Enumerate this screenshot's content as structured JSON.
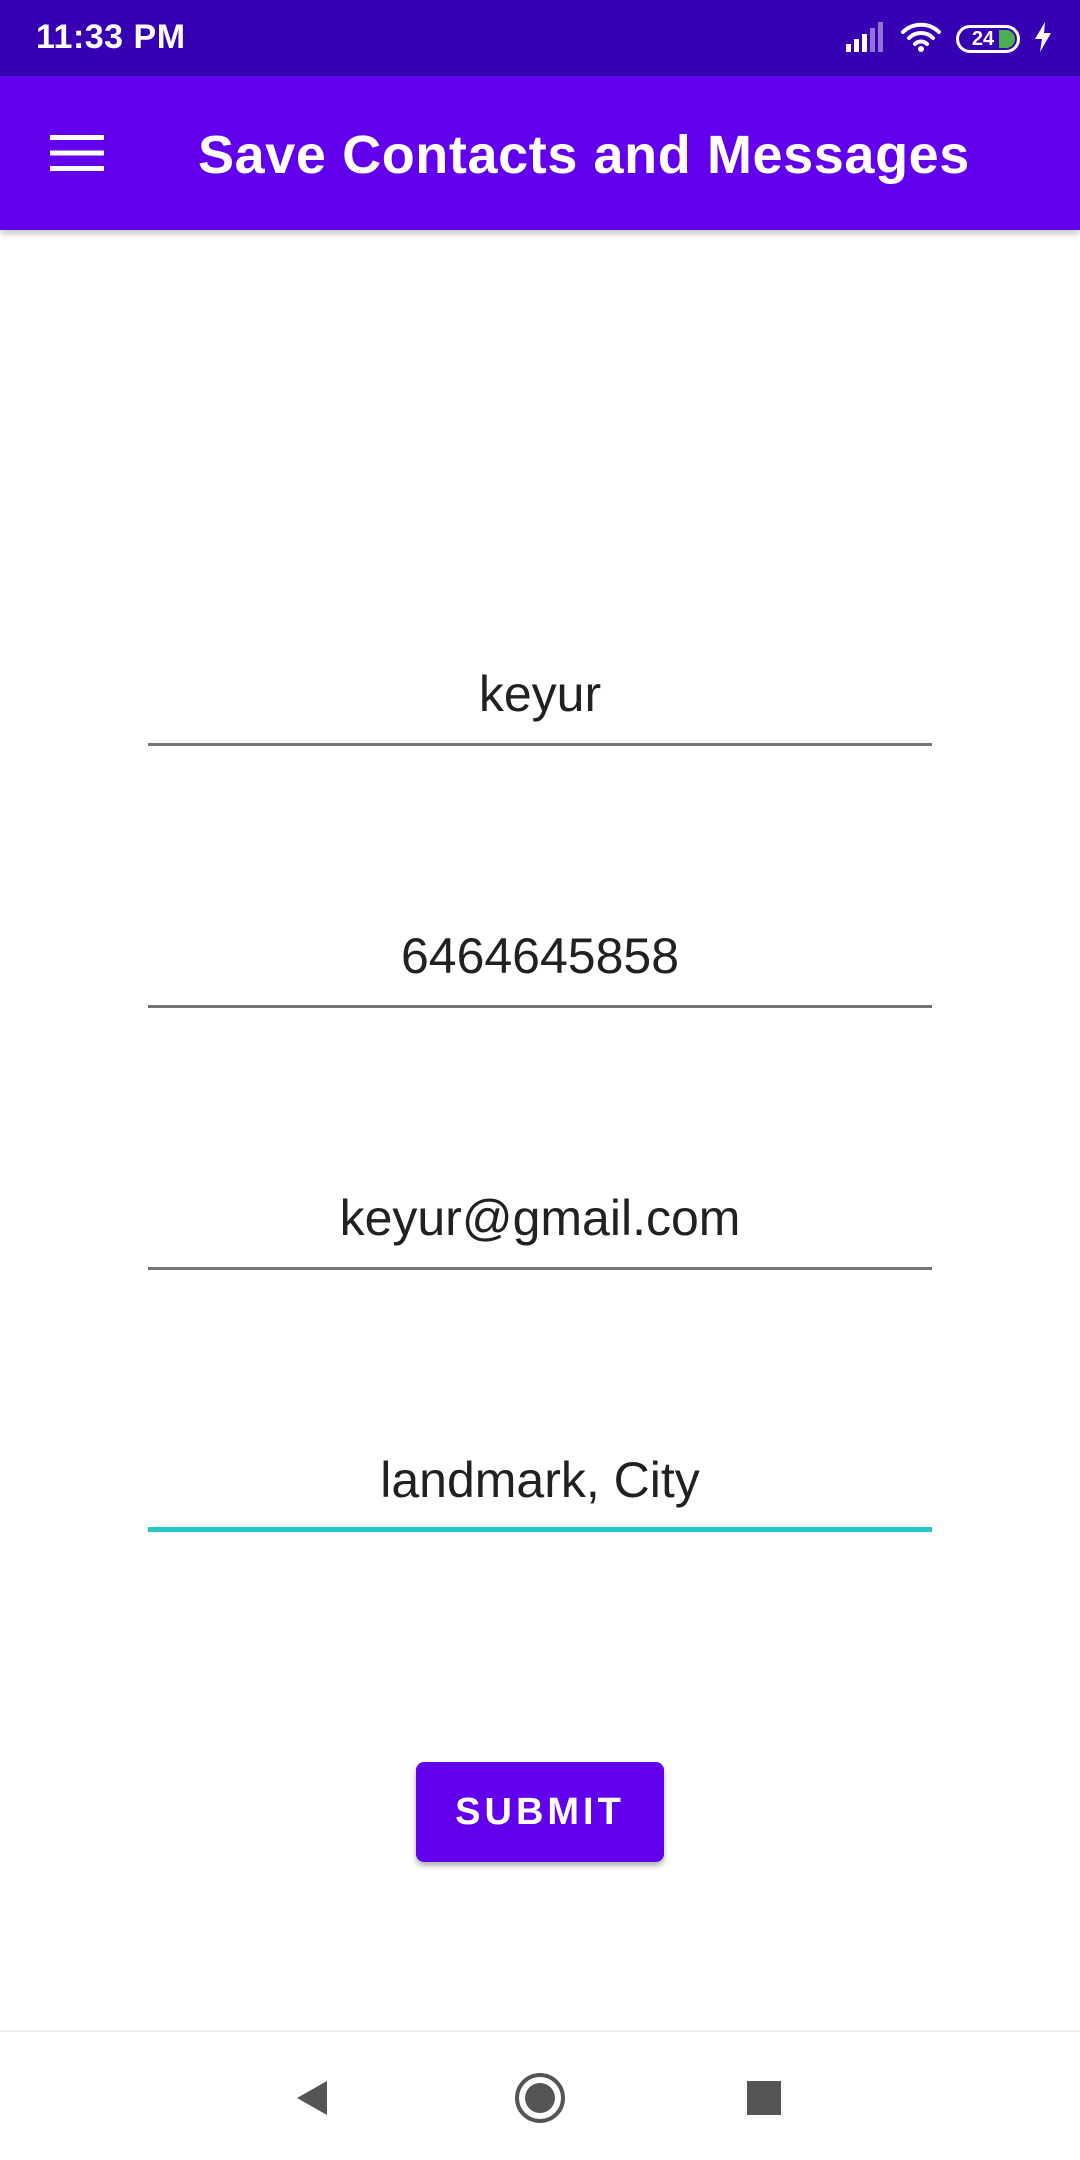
{
  "status_bar": {
    "time": "11:33 PM",
    "battery_level": "24",
    "icons": [
      "signal-icon",
      "wifi-icon",
      "battery-icon",
      "charging-icon"
    ]
  },
  "app_bar": {
    "title": "Save Contacts and Messages",
    "menu_icon": "menu-icon",
    "color": "#6200ee"
  },
  "form": {
    "name_value": "keyur",
    "phone_value": "6464645858",
    "email_value": "keyur@gmail.com",
    "address_value": "landmark, City",
    "focused_field": "address",
    "focus_color": "#26c6c6"
  },
  "submit": {
    "label": "SUBMIT"
  },
  "nav_bar": {
    "icons": [
      "back-icon",
      "home-icon",
      "recents-icon"
    ]
  }
}
